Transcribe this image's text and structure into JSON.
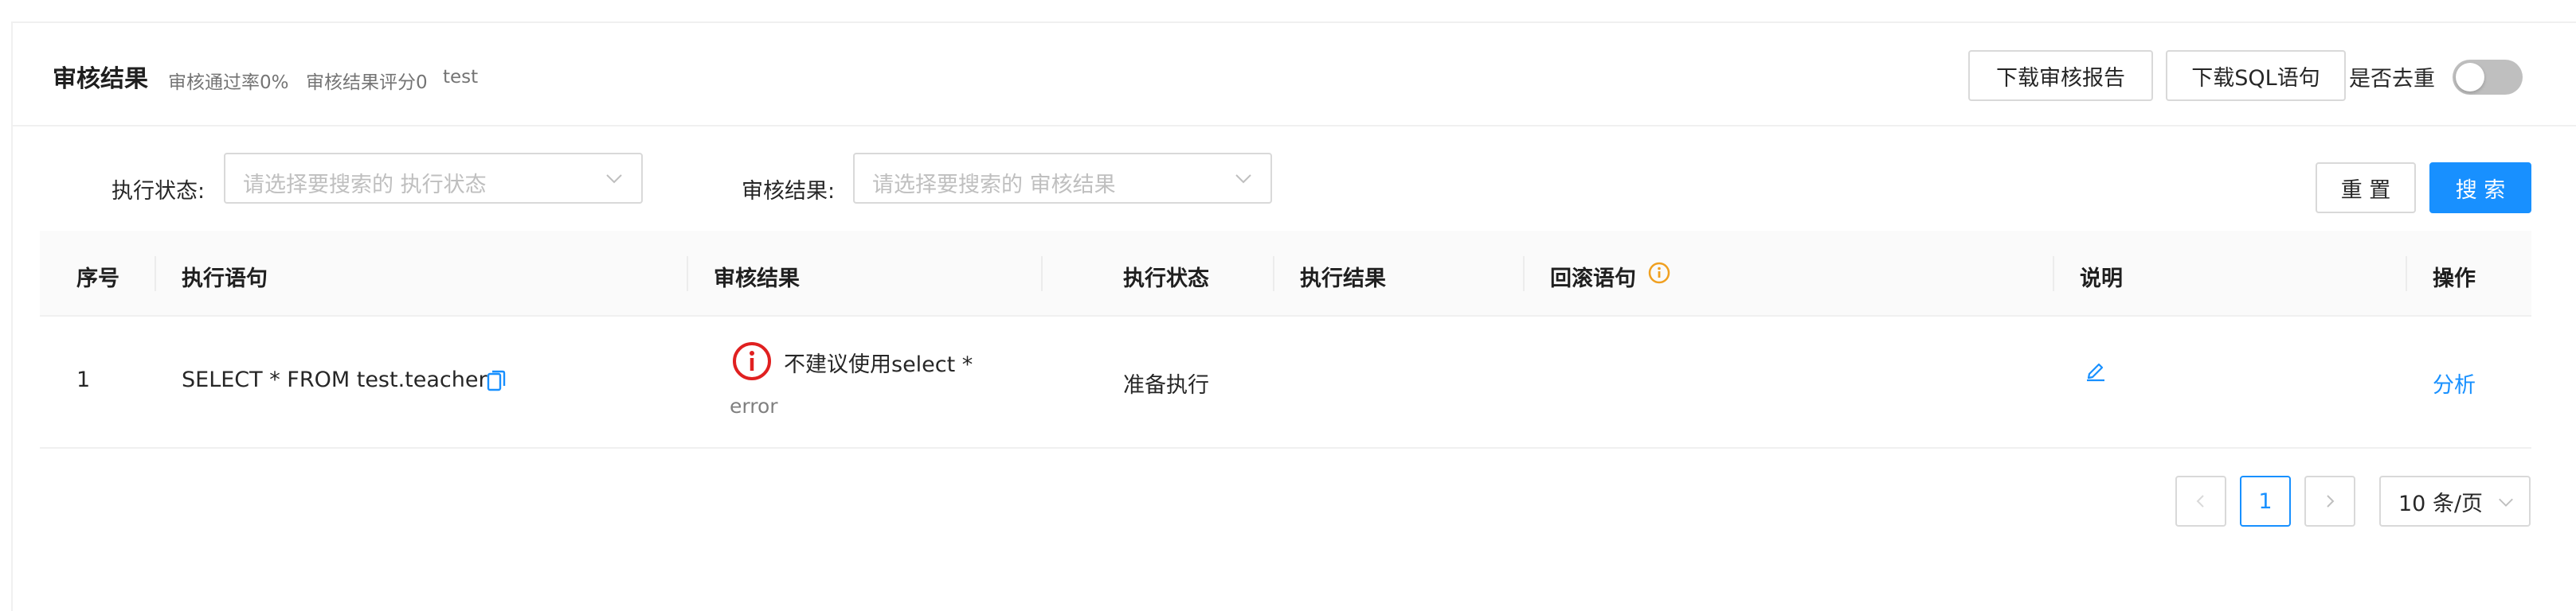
{
  "header": {
    "title": "审核结果",
    "pass_rate": "审核通过率0%",
    "score": "审核结果评分0",
    "instance": "test",
    "download_report_label": "下载审核报告",
    "download_sql_label": "下载SQL语句",
    "dedupe_label": "是否去重",
    "dedupe_enabled": false
  },
  "filters": {
    "exec_status_label": "执行状态",
    "exec_status_placeholder": "请选择要搜索的 执行状态",
    "audit_result_label": "审核结果",
    "audit_result_placeholder": "请选择要搜索的 审核结果",
    "reset_label": "重 置",
    "search_label": "搜 索"
  },
  "table": {
    "columns": [
      "序号",
      "执行语句",
      "审核结果",
      "执行状态",
      "执行结果",
      "回滚语句",
      "说明",
      "操作"
    ],
    "rows": [
      {
        "index": "1",
        "sql": "SELECT * FROM test.teacher",
        "audit_message": "不建议使用select *",
        "audit_level": "error",
        "exec_status": "准备执行",
        "exec_result": "",
        "rollback": "",
        "action": "分析"
      }
    ]
  },
  "pagination": {
    "current_page": "1",
    "page_size": "10 条/页"
  },
  "colors": {
    "primary": "#1890ff",
    "error": "#e02020",
    "warning": "#f0a020"
  }
}
